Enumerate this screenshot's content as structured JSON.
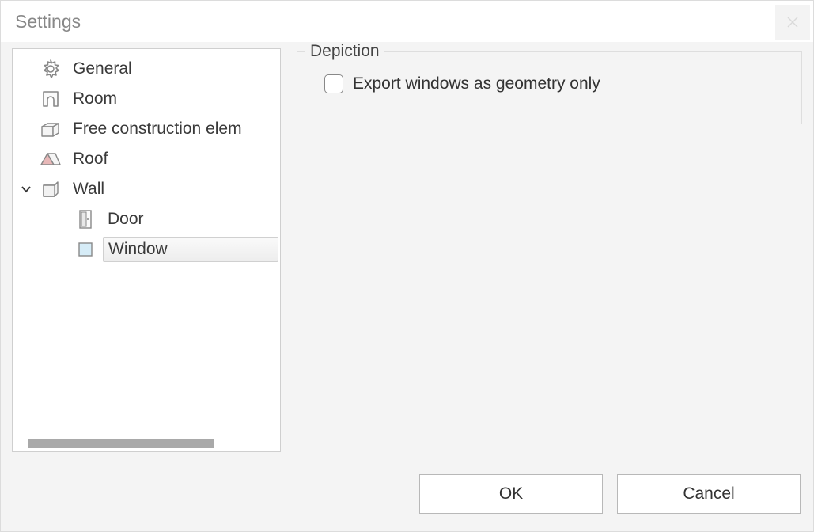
{
  "window": {
    "title": "Settings"
  },
  "tree": {
    "items": [
      {
        "label": "General"
      },
      {
        "label": "Room"
      },
      {
        "label": "Free construction elem"
      },
      {
        "label": "Roof"
      },
      {
        "label": "Wall",
        "expanded": true,
        "children": [
          {
            "label": "Door"
          },
          {
            "label": "Window",
            "selected": true
          }
        ]
      }
    ]
  },
  "content": {
    "group_title": "Depiction",
    "checkbox_label": "Export windows as geometry only",
    "checkbox_checked": false
  },
  "footer": {
    "ok": "OK",
    "cancel": "Cancel"
  }
}
